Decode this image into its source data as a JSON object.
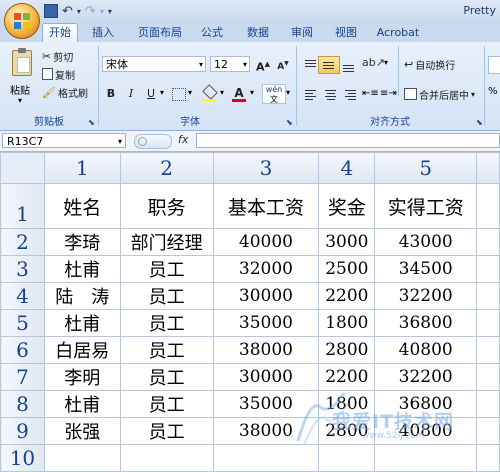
{
  "title_bar": {
    "title": "Pretty",
    "qat_undo": "↶",
    "qat_redo": "↷"
  },
  "tabs": [
    "开始",
    "插入",
    "页面布局",
    "公式",
    "数据",
    "审阅",
    "视图",
    "Acrobat"
  ],
  "active_tab": "开始",
  "clipboard": {
    "paste": "粘贴",
    "cut": "剪切",
    "copy": "复制",
    "format_painter": "格式刷",
    "group_label": "剪贴板"
  },
  "font": {
    "name": "宋体",
    "size": "12",
    "grow": "A",
    "shrink": "A",
    "bold": "B",
    "italic": "I",
    "underline": "U",
    "wen": "wén",
    "group_label": "字体"
  },
  "alignment": {
    "wrap_text": "自动换行",
    "merge_center": "合并后居中",
    "group_label": "对齐方式"
  },
  "formula_bar": {
    "cell_ref": "R13C7",
    "fx": "fx",
    "value": ""
  },
  "columns": [
    "1",
    "2",
    "3",
    "4",
    "5"
  ],
  "rows": [
    {
      "num": "1",
      "cells": [
        "姓名",
        "职务",
        "基本工资",
        "奖金",
        "实得工资"
      ]
    },
    {
      "num": "2",
      "cells": [
        "李琦",
        "部门经理",
        "40000",
        "3000",
        "43000"
      ]
    },
    {
      "num": "3",
      "cells": [
        "杜甫",
        "员工",
        "32000",
        "2500",
        "34500"
      ]
    },
    {
      "num": "4",
      "cells": [
        "陆　涛",
        "员工",
        "30000",
        "2200",
        "32200"
      ]
    },
    {
      "num": "5",
      "cells": [
        "杜甫",
        "员工",
        "35000",
        "1800",
        "36800"
      ]
    },
    {
      "num": "6",
      "cells": [
        "白居易",
        "员工",
        "38000",
        "2800",
        "40800"
      ]
    },
    {
      "num": "7",
      "cells": [
        "李明",
        "员工",
        "30000",
        "2200",
        "32200"
      ]
    },
    {
      "num": "8",
      "cells": [
        "杜甫",
        "员工",
        "35000",
        "1800",
        "36800"
      ]
    },
    {
      "num": "9",
      "cells": [
        "张强",
        "员工",
        "38000",
        "2800",
        "40800"
      ]
    },
    {
      "num": "10",
      "cells": [
        "",
        "",
        "",
        "",
        ""
      ]
    }
  ],
  "watermark": {
    "text": "我爱IT技术网",
    "url": "www.52ij.com"
  }
}
